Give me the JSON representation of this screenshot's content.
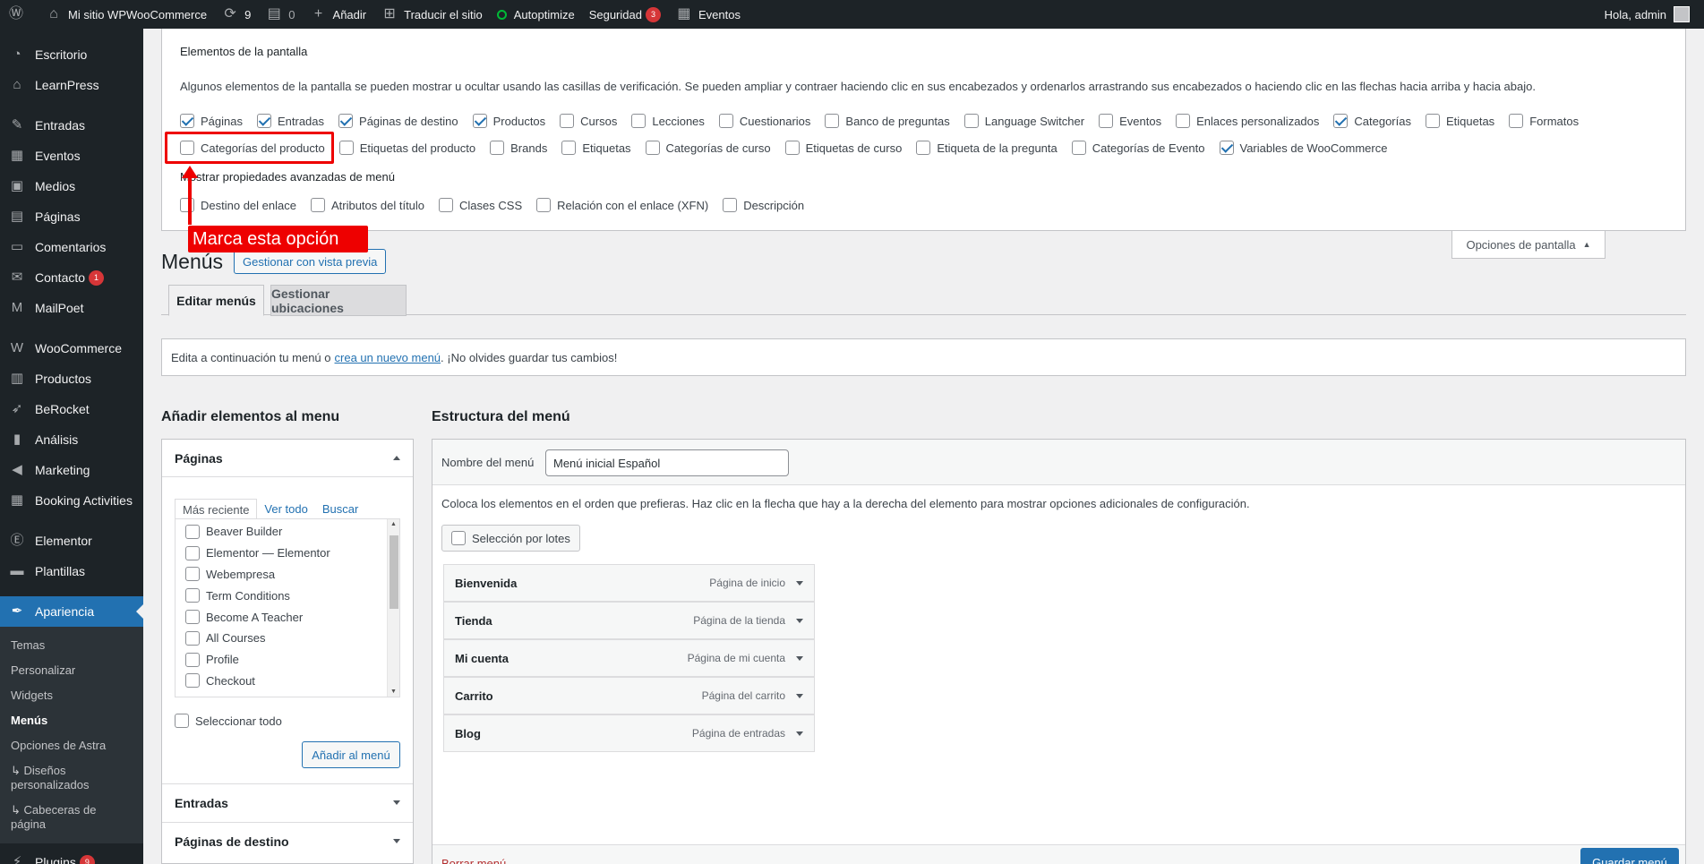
{
  "adminbar": {
    "site": "Mi sitio WPWooCommerce",
    "updates": "9",
    "comments": "0",
    "add": "Añadir",
    "translate": "Traducir el sitio",
    "autoptimize": "Autoptimize",
    "security": "Seguridad",
    "security_count": "3",
    "events": "Eventos",
    "greeting": "Hola, admin"
  },
  "sidebar": {
    "items": [
      {
        "label": "Escritorio",
        "icon": "dashboard-icon"
      },
      {
        "label": "LearnPress",
        "icon": "graduation-cap-icon"
      },
      {
        "label": "Entradas",
        "icon": "pushpin-icon"
      },
      {
        "label": "Eventos",
        "icon": "calendar-icon"
      },
      {
        "label": "Medios",
        "icon": "media-icon"
      },
      {
        "label": "Páginas",
        "icon": "page-icon"
      },
      {
        "label": "Comentarios",
        "icon": "comment-icon"
      },
      {
        "label": "Contacto",
        "icon": "mail-icon",
        "badge": "1"
      },
      {
        "label": "MailPoet",
        "icon": "mailpoet-icon"
      },
      {
        "label": "WooCommerce",
        "icon": "woo-icon"
      },
      {
        "label": "Productos",
        "icon": "archive-icon"
      },
      {
        "label": "BeRocket",
        "icon": "rocket-icon"
      },
      {
        "label": "Análisis",
        "icon": "chart-bar-icon"
      },
      {
        "label": "Marketing",
        "icon": "megaphone-icon"
      },
      {
        "label": "Booking Activities",
        "icon": "calendar-grid-icon"
      },
      {
        "label": "Elementor",
        "icon": "elementor-icon"
      },
      {
        "label": "Plantillas",
        "icon": "folder-icon"
      },
      {
        "label": "Apariencia",
        "icon": "brush-icon"
      }
    ],
    "submenu": [
      "Temas",
      "Personalizar",
      "Widgets",
      "Menús",
      "Opciones de Astra",
      "↳ Diseños personalizados",
      "↳ Cabeceras de página"
    ],
    "plugins": {
      "label": "Plugins",
      "icon": "plug-icon",
      "badge": "9"
    }
  },
  "screen_options": {
    "title": "Elementos de la pantalla",
    "description": "Algunos elementos de la pantalla se pueden mostrar u ocultar usando las casillas de verificación. Se pueden ampliar y contraer haciendo clic en sus encabezados y ordenarlos arrastrando sus encabezados o haciendo clic en las flechas hacia arriba y hacia abajo.",
    "row1": [
      {
        "label": "Páginas",
        "checked": true
      },
      {
        "label": "Entradas",
        "checked": true
      },
      {
        "label": "Páginas de destino",
        "checked": true
      },
      {
        "label": "Productos",
        "checked": true
      },
      {
        "label": "Cursos",
        "checked": false
      },
      {
        "label": "Lecciones",
        "checked": false
      },
      {
        "label": "Cuestionarios",
        "checked": false
      },
      {
        "label": "Banco de preguntas",
        "checked": false
      },
      {
        "label": "Language Switcher",
        "checked": false
      },
      {
        "label": "Eventos",
        "checked": false
      },
      {
        "label": "Enlaces personalizados",
        "checked": false
      },
      {
        "label": "Categorías",
        "checked": true
      },
      {
        "label": "Etiquetas",
        "checked": false
      },
      {
        "label": "Formatos",
        "checked": false
      }
    ],
    "row2": [
      {
        "label": "Categorías del producto",
        "checked": false
      },
      {
        "label": "Etiquetas del producto",
        "checked": false
      },
      {
        "label": "Brands",
        "checked": false
      },
      {
        "label": "Etiquetas",
        "checked": false
      },
      {
        "label": "Categorías de curso",
        "checked": false
      },
      {
        "label": "Etiquetas de curso",
        "checked": false
      },
      {
        "label": "Etiqueta de la pregunta",
        "checked": false
      },
      {
        "label": "Categorías de Evento",
        "checked": false
      },
      {
        "label": "Variables de WooCommerce",
        "checked": true
      }
    ],
    "advanced_title": "Mostrar propiedades avanzadas de menú",
    "row3": [
      {
        "label": "Destino del enlace",
        "checked": false
      },
      {
        "label": "Atributos del título",
        "checked": false
      },
      {
        "label": "Clases CSS",
        "checked": false
      },
      {
        "label": "Relación con el enlace (XFN)",
        "checked": false
      },
      {
        "label": "Descripción",
        "checked": false
      }
    ],
    "tab_label": "Opciones de pantalla"
  },
  "annotation": {
    "label": "Marca esta opción"
  },
  "page": {
    "title": "Menús",
    "preview_button": "Gestionar con vista previa",
    "tab_edit": "Editar menús",
    "tab_locations": "Gestionar ubicaciones",
    "notice_before": "Edita a continuación tu menú o",
    "notice_link": "crea un nuevo menú",
    "notice_after": ". ¡No olvides guardar tus cambios!"
  },
  "add_items": {
    "heading": "Añadir elementos al menu",
    "pages_title": "Páginas",
    "tabs": [
      "Más reciente",
      "Ver todo",
      "Buscar"
    ],
    "pages": [
      "Beaver Builder",
      "Elementor — Elementor",
      "Webempresa",
      "Term Conditions",
      "Become A Teacher",
      "All Courses",
      "Profile",
      "Checkout"
    ],
    "select_all": "Seleccionar todo",
    "add_button": "Añadir al menú",
    "entradas_title": "Entradas",
    "destino_title": "Páginas de destino"
  },
  "structure": {
    "heading": "Estructura del menú",
    "name_label": "Nombre del menú",
    "name_value": "Menú inicial Español",
    "instructions": "Coloca los elementos en el orden que prefieras. Haz clic en la flecha que hay a la derecha del elemento para mostrar opciones adicionales de configuración.",
    "bulk_label": "Selección por lotes",
    "items": [
      {
        "title": "Bienvenida",
        "type": "Página de inicio"
      },
      {
        "title": "Tienda",
        "type": "Página de la tienda"
      },
      {
        "title": "Mi cuenta",
        "type": "Página de mi cuenta"
      },
      {
        "title": "Carrito",
        "type": "Página del carrito"
      },
      {
        "title": "Blog",
        "type": "Página de entradas"
      }
    ],
    "delete_link": "Borrar menú",
    "save_button": "Guardar menú"
  },
  "colors": {
    "accent": "#2271b1",
    "sidebar": "#1d2327",
    "annotation": "#ee0000"
  }
}
